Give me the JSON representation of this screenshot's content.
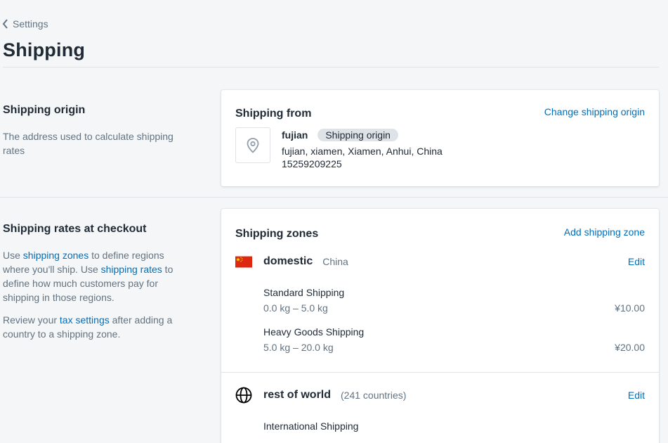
{
  "breadcrumb": {
    "label": "Settings"
  },
  "page": {
    "title": "Shipping"
  },
  "origin_section": {
    "title": "Shipping origin",
    "description": "The address used to calculate shipping rates"
  },
  "origin_card": {
    "title": "Shipping from",
    "action": "Change shipping origin",
    "icon": "location-pin-icon",
    "name": "fujian",
    "badge": "Shipping origin",
    "address": "fujian, xiamen, Xiamen, Anhui, China",
    "phone": "15259209225"
  },
  "rates_section": {
    "title": "Shipping rates at checkout",
    "p1_a": "Use ",
    "p1_link1": "shipping zones",
    "p1_b": " to define regions where you'll ship. Use ",
    "p1_link2": "shipping rates",
    "p1_c": " to define how much customers pay for shipping in those regions.",
    "p2_a": "Review your ",
    "p2_link": "tax settings",
    "p2_b": " after adding a country to a shipping zone."
  },
  "zones_card": {
    "title": "Shipping zones",
    "action": "Add shipping zone",
    "zones": [
      {
        "name": "domestic",
        "meta": "China",
        "icon": "china-flag-icon",
        "edit": "Edit",
        "rates": [
          {
            "name": "Standard Shipping",
            "range": "0.0 kg – 5.0 kg",
            "price": "¥10.00"
          },
          {
            "name": "Heavy Goods Shipping",
            "range": "5.0 kg – 20.0 kg",
            "price": "¥20.00"
          }
        ]
      },
      {
        "name": "rest of world",
        "meta": "(241 countries)",
        "icon": "globe-icon",
        "edit": "Edit",
        "rates": [
          {
            "name": "International Shipping"
          }
        ]
      }
    ]
  },
  "colors": {
    "link": "#006fbb",
    "muted": "#637381",
    "flag_red": "#de2910",
    "flag_yellow": "#ffde00"
  }
}
